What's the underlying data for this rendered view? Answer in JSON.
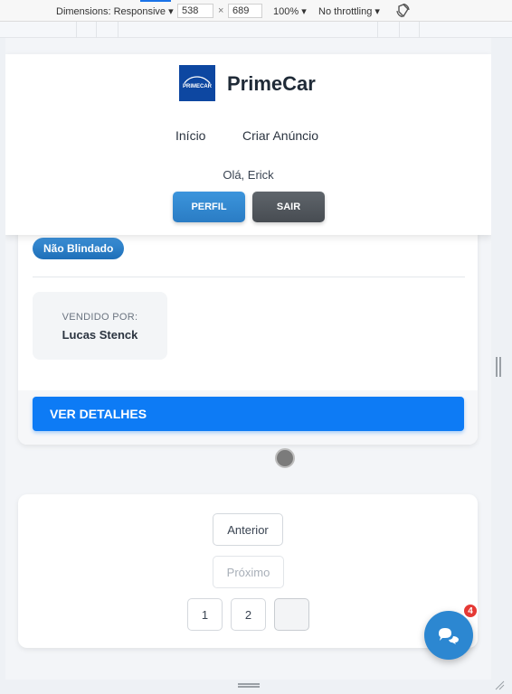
{
  "devtools": {
    "dimensions_label": "Dimensions: Responsive ▾",
    "width": "538",
    "times": "×",
    "height": "689",
    "zoom": "100% ▾",
    "throttling": "No throttling ▾"
  },
  "header": {
    "brand": "PrimeCar",
    "logo_text": "PRIMECAR",
    "nav": [
      "Início",
      "Criar Anúncio"
    ],
    "greeting": "Olá, Erick",
    "profile_button": "PERFIL",
    "logout_button": "SAIR"
  },
  "car_card": {
    "badge": "Não Blindado",
    "seller_label": "VENDIDO POR:",
    "seller_name": "Lucas Stenck",
    "details_button": "VER DETALHES"
  },
  "pagination": {
    "previous": "Anterior",
    "next": "Próximo",
    "pages": [
      "1",
      "2",
      ""
    ]
  },
  "chat": {
    "badge_count": "4"
  },
  "colors": {
    "primary": "#0d7bf5",
    "brand_blue": "#0d47a1",
    "profile_button": "#2f86cf",
    "logout_button": "#4f555b",
    "chat_button": "#2c87d1",
    "notification": "#e53935"
  }
}
